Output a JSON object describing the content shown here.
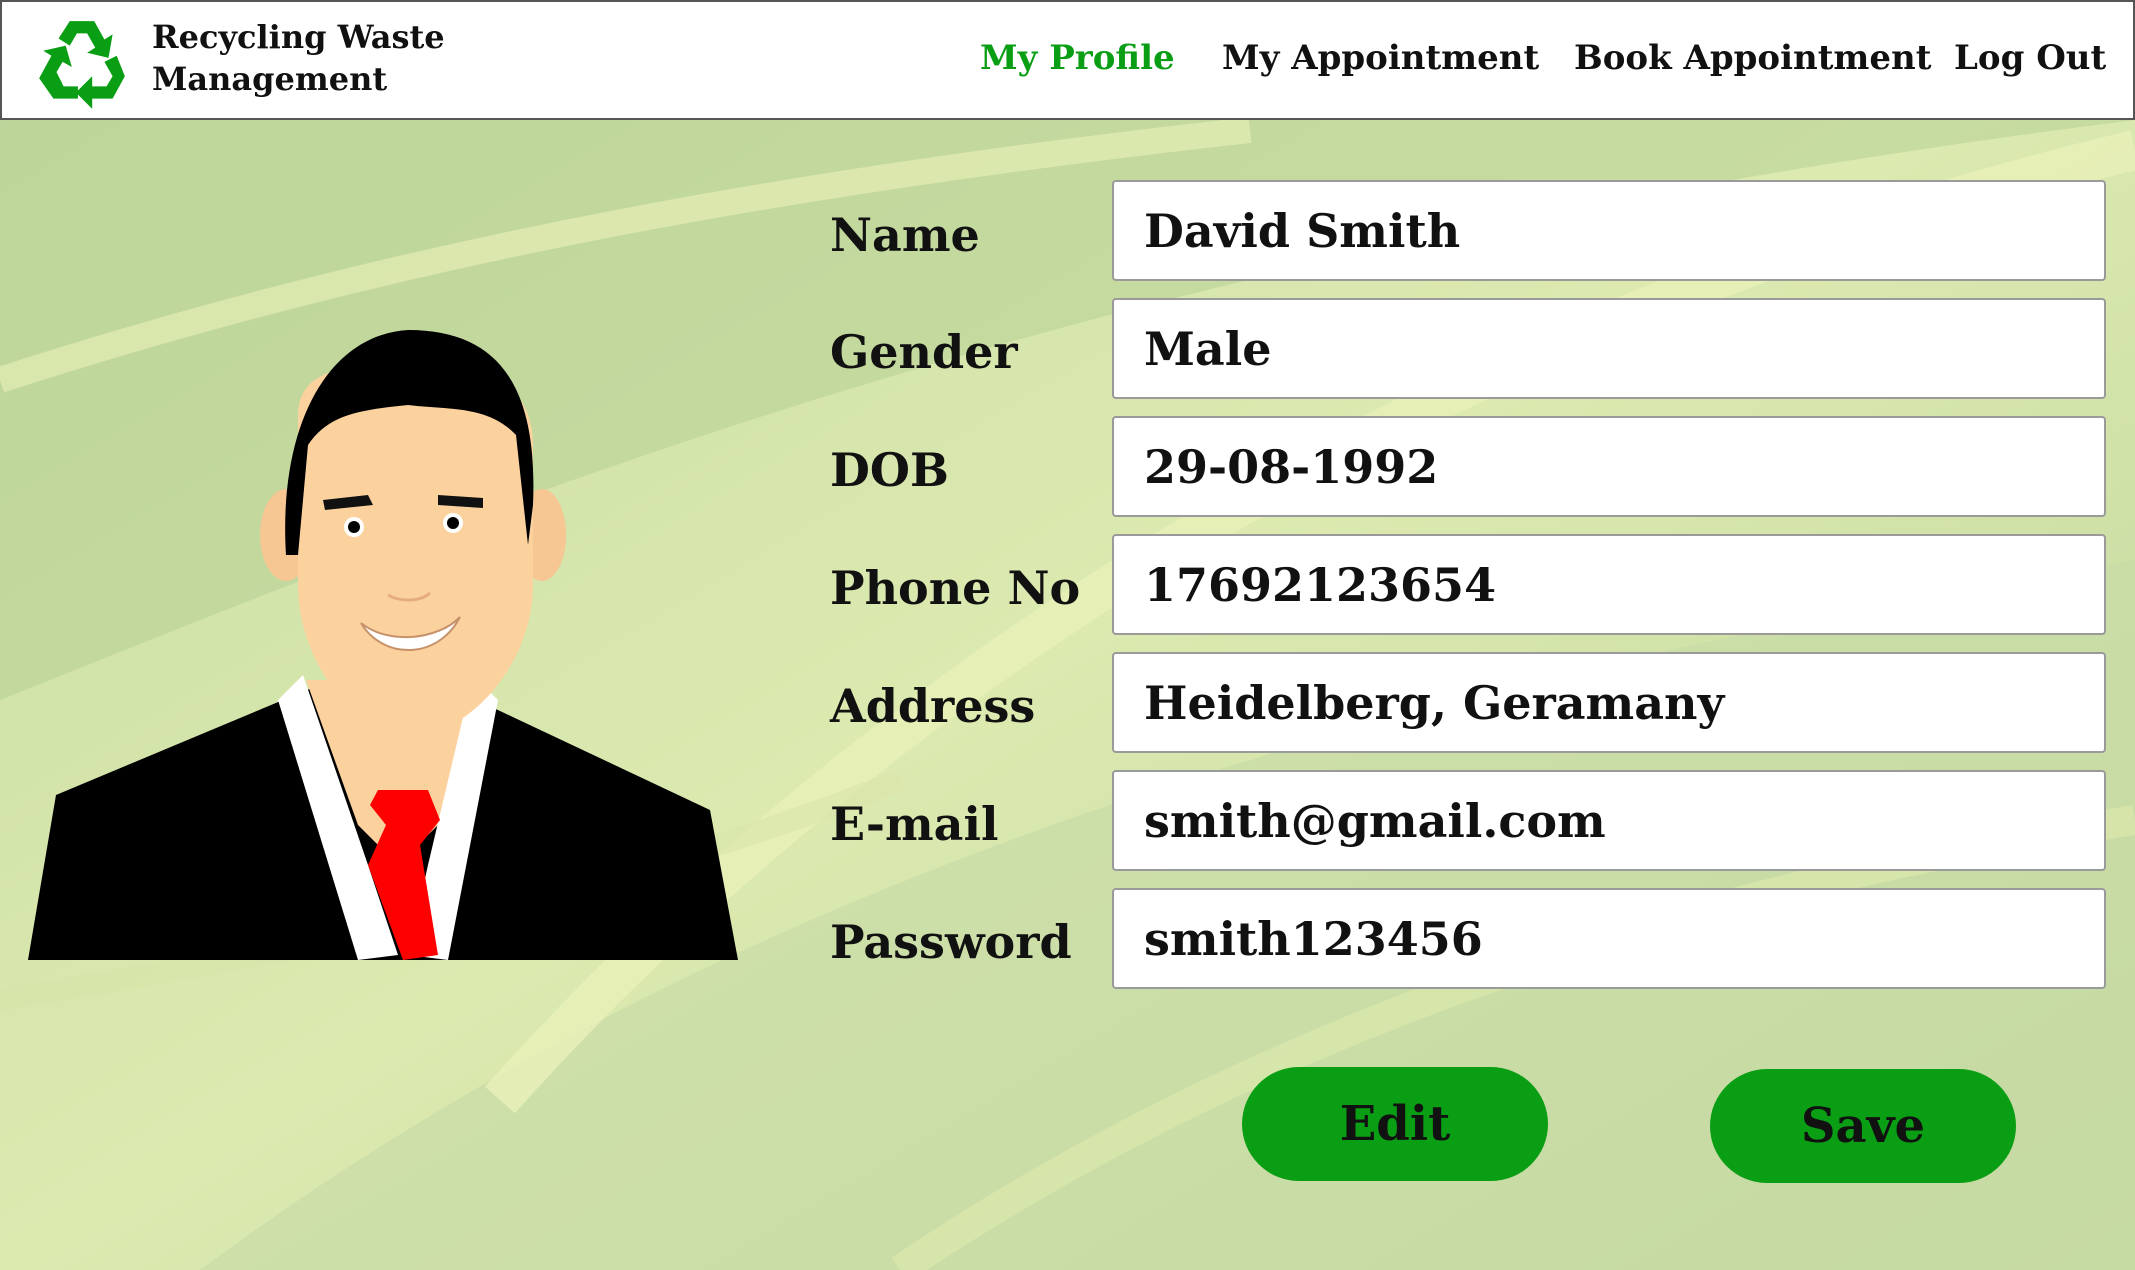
{
  "brand": {
    "line1": "Recycling Waste",
    "line2": "Management"
  },
  "nav": [
    {
      "label": "My Profile",
      "active": true
    },
    {
      "label": "My Appointment",
      "active": false
    },
    {
      "label": "Book Appointment",
      "active": false
    },
    {
      "label": "Log Out",
      "active": false
    }
  ],
  "profile": {
    "name": {
      "label": "Name",
      "value": "David Smith"
    },
    "gender": {
      "label": "Gender",
      "value": "Male"
    },
    "dob": {
      "label": "DOB",
      "value": "29-08-1992"
    },
    "phone": {
      "label": "Phone No",
      "value": "17692123654"
    },
    "address": {
      "label": "Address",
      "value": "Heidelberg, Geramany"
    },
    "email": {
      "label": "E-mail",
      "value": "smith@gmail.com"
    },
    "password": {
      "label": "Password",
      "value": "smith123456"
    }
  },
  "buttons": {
    "edit": "Edit",
    "save": "Save"
  },
  "colors": {
    "accent": "#0a9e14",
    "tie": "#ff0000",
    "suit": "#000000",
    "skin": "#fbd29e"
  },
  "icons": {
    "logo": "recycle-icon",
    "avatar": "businessman-avatar"
  }
}
